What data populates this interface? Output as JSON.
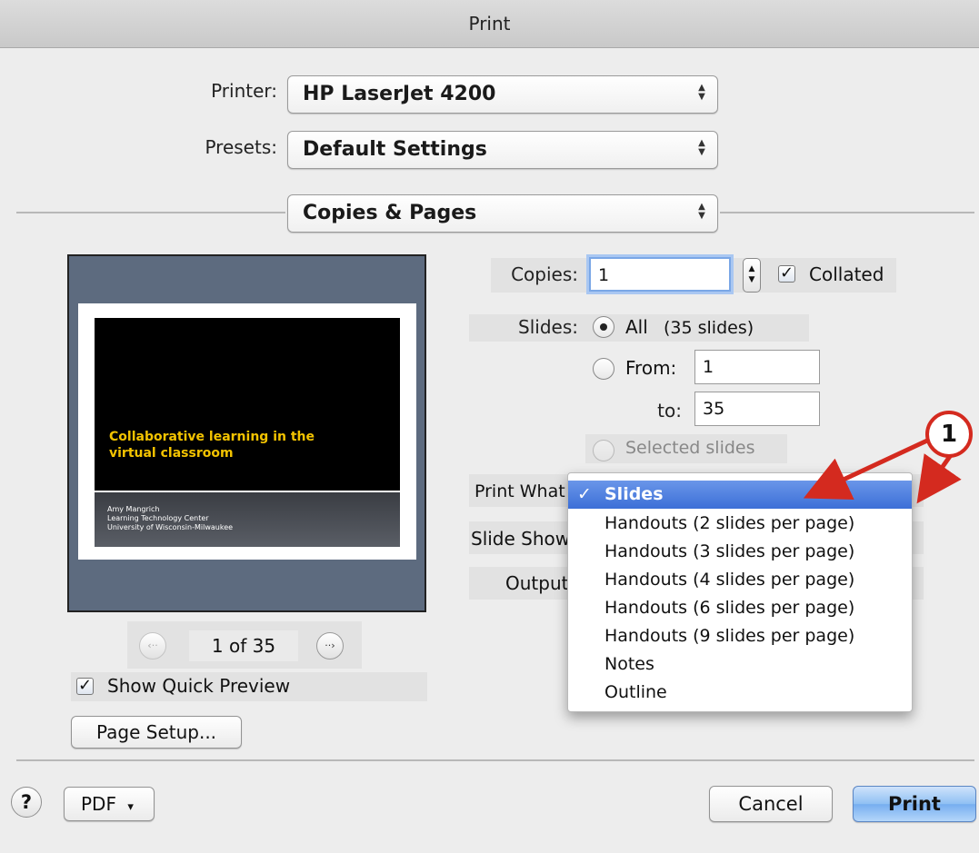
{
  "window": {
    "title": "Print"
  },
  "printer": {
    "label": "Printer:",
    "value": "HP LaserJet 4200"
  },
  "presets": {
    "label": "Presets:",
    "value": "Default Settings"
  },
  "section": {
    "value": "Copies & Pages"
  },
  "preview": {
    "slide_title": "Collaborative learning in the virtual classroom",
    "slide_author": "Amy Mangrich",
    "slide_org1": "Learning Technology Center",
    "slide_org2": "University of Wisconsin-Milwaukee",
    "page_indicator": "1 of 35",
    "prev_glyph": "‹··",
    "next_glyph": "··›"
  },
  "show_quick_preview": {
    "label": "Show Quick Preview",
    "checked": true
  },
  "page_setup_button": "Page Setup...",
  "copies": {
    "label": "Copies:",
    "value": "1",
    "collated_label": "Collated",
    "collated": true
  },
  "slides": {
    "label": "Slides:",
    "all_label": "All",
    "all_count": "(35 slides)",
    "from_label": "From:",
    "from_value": "1",
    "to_label": "to:",
    "to_value": "35",
    "selected_label": "Selected slides"
  },
  "left_labels": {
    "print_what": "Print What",
    "slide_show": "Slide Show",
    "output": "Output"
  },
  "print_what_menu": {
    "check_glyph": "✓",
    "items": [
      "Slides",
      "Handouts (2 slides per page)",
      "Handouts (3 slides per page)",
      "Handouts (4 slides per page)",
      "Handouts (6 slides per page)",
      "Handouts (9 slides per page)",
      "Notes",
      "Outline"
    ],
    "selected_index": 0
  },
  "callout": {
    "number": "1"
  },
  "bottom": {
    "help": "?",
    "pdf": "PDF",
    "pdf_arrow": "▾",
    "cancel": "Cancel",
    "print": "Print"
  },
  "colors": {
    "accent": "#3c6fd7",
    "callout": "#d42a1f",
    "slide_title": "#f3c300"
  }
}
